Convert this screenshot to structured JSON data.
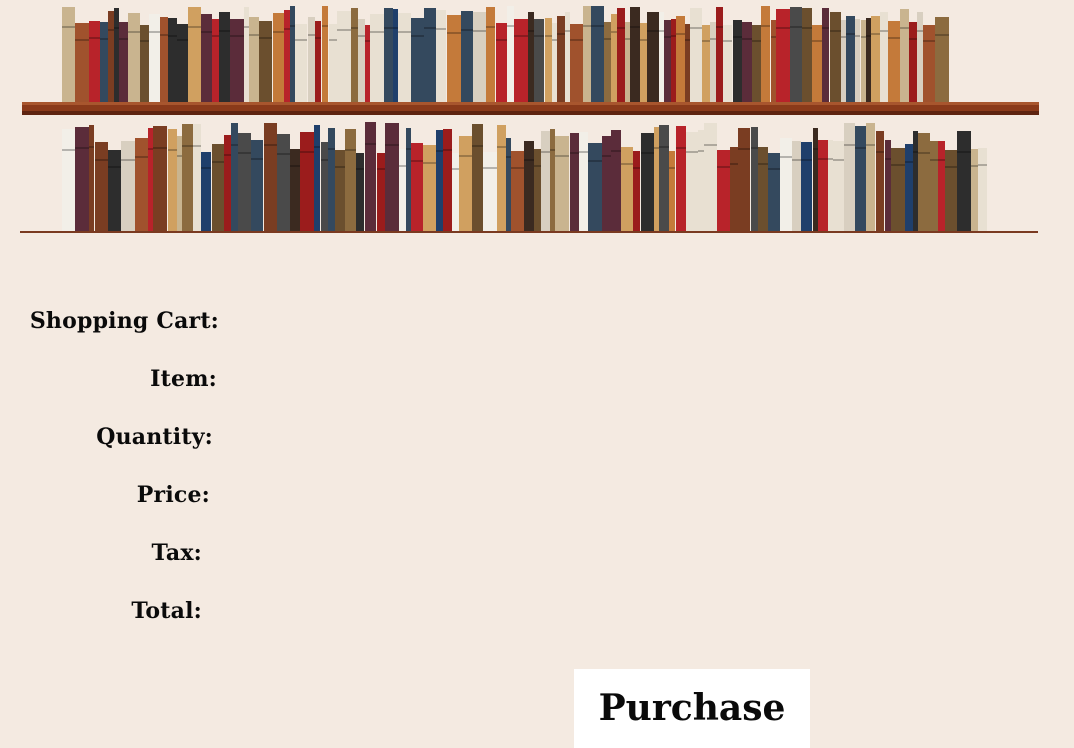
{
  "header": {
    "image_name": "bookshelf-banner"
  },
  "cart": {
    "heading": "Shopping Cart:",
    "item_label": "Item:",
    "quantity_label": "Quantity:",
    "price_label": "Price:",
    "tax_label": "Tax:",
    "total_label": "Total:"
  },
  "actions": {
    "purchase_label": "Purchase"
  },
  "colors": {
    "background": "#f4eae1",
    "button_background": "#ffffff",
    "text": "#0a0a0a",
    "shelf_wood": "#8a3a1a"
  }
}
